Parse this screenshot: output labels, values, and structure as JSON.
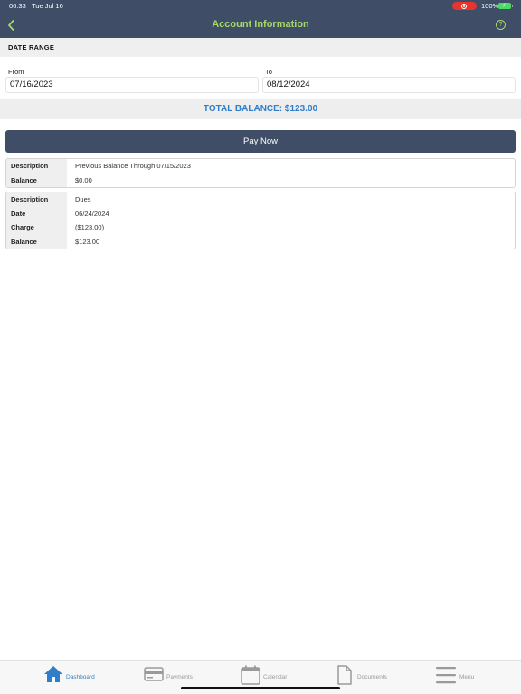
{
  "status_bar": {
    "time": "06:33",
    "date": "Tue Jul 16",
    "battery_percent": "100%",
    "recording_icon": "screen-record-icon",
    "battery_icon": "battery-charging-icon"
  },
  "header": {
    "title": "Account Information",
    "back_icon": "chevron-left-icon",
    "help_icon": "help-icon",
    "help_glyph": "?",
    "background_color": "#3f4e66",
    "title_color": "#a5d86a"
  },
  "date_range": {
    "section_title": "DATE RANGE",
    "from_label": "From",
    "from_value": "07/16/2023",
    "to_label": "To",
    "to_value": "08/12/2024"
  },
  "total_balance": {
    "text": "TOTAL BALANCE: $123.00",
    "color": "#2f7ec9"
  },
  "pay_now": {
    "label": "Pay Now"
  },
  "transactions": [
    {
      "rows": [
        {
          "label": "Description",
          "value": "Previous Balance Through 07/15/2023"
        },
        {
          "label": "Balance",
          "value": "$0.00"
        }
      ]
    },
    {
      "rows": [
        {
          "label": "Description",
          "value": "Dues"
        },
        {
          "label": "Date",
          "value": "06/24/2024"
        },
        {
          "label": "Charge",
          "value": "($123.00)"
        },
        {
          "label": "Balance",
          "value": "$123.00"
        }
      ]
    }
  ],
  "tabbar": {
    "active_index": 0,
    "active_color": "#2f7ec9",
    "items": [
      {
        "label": "Dashboard",
        "icon": "home-icon"
      },
      {
        "label": "Payments",
        "icon": "credit-card-icon"
      },
      {
        "label": "Calendar",
        "icon": "calendar-icon"
      },
      {
        "label": "Documents",
        "icon": "document-icon"
      },
      {
        "label": "Menu",
        "icon": "hamburger-menu-icon"
      }
    ]
  }
}
